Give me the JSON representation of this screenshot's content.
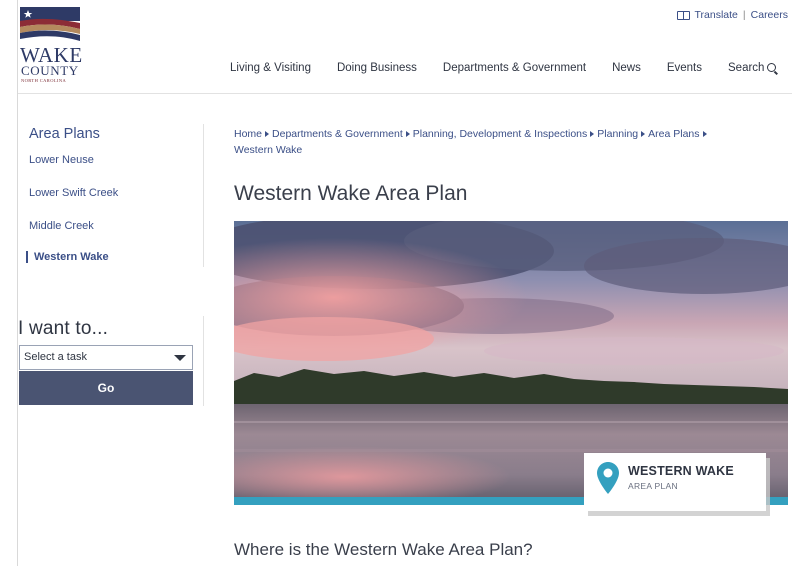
{
  "logo": {
    "line1": "WAKE",
    "line2": "COUNTY",
    "line3": "NORTH CAROLINA"
  },
  "utility": {
    "translate_label": "Translate",
    "separator": "|",
    "careers_label": "Careers"
  },
  "nav": {
    "items": [
      "Living & Visiting",
      "Doing Business",
      "Departments & Government",
      "News",
      "Events",
      "Search"
    ]
  },
  "sidebar": {
    "title": "Area Plans",
    "items": [
      {
        "label": "Lower Neuse",
        "active": false
      },
      {
        "label": "Lower Swift Creek",
        "active": false
      },
      {
        "label": "Middle Creek",
        "active": false
      },
      {
        "label": "Western Wake",
        "active": true
      }
    ]
  },
  "want": {
    "title": "I want to...",
    "select_value": "Select a task",
    "go_label": "Go"
  },
  "breadcrumb": [
    "Home",
    "Departments & Government",
    "Planning, Development & Inspections",
    "Planning",
    "Area Plans",
    "Western Wake"
  ],
  "main": {
    "title": "Western Wake Area Plan",
    "badge_title": "WESTERN WAKE",
    "badge_subtitle": "AREA PLAN",
    "section_heading": "Where is the Western Wake Area Plan?"
  },
  "colors": {
    "brand_navy": "#3b4f87",
    "button": "#4a5472",
    "accent_teal": "#34a0bf"
  }
}
